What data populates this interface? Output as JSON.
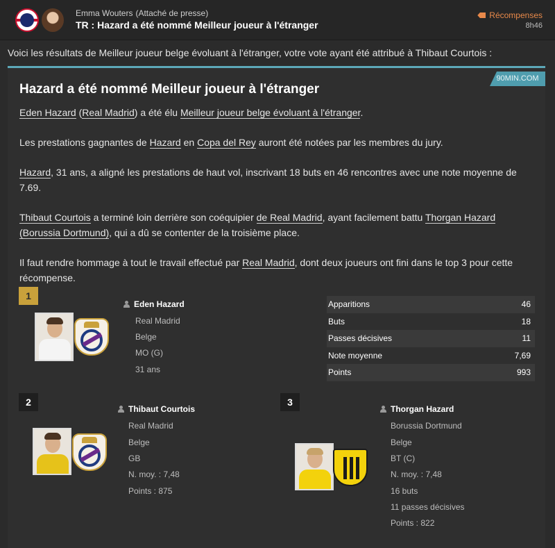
{
  "header": {
    "sender_name": "Emma Wouters",
    "sender_role": "(Attaché de presse)",
    "subject": "TR : Hazard a été nommé Meilleur joueur à l'étranger",
    "category_label": "Récompenses",
    "time": "8h46"
  },
  "intro": {
    "text_prefix": "Voici les résultats de Meilleur joueur belge évoluant à l'étranger, votre vote ayant été attribué à ",
    "voted_player": "Thibaut Courtois",
    "text_suffix": " :"
  },
  "article": {
    "source": "90MIN.COM",
    "headline": "Hazard a été nommé Meilleur joueur à l'étranger",
    "p1": {
      "player": "Eden Hazard",
      "club_open": "(",
      "club": "Real Madrid",
      "club_close": ")",
      "text1": " a été élu ",
      "award": "Meilleur joueur belge évoluant à l'étranger",
      "text2": "."
    },
    "p2": {
      "text1": "Les prestations gagnantes de ",
      "player": "Hazard",
      "text2": " en ",
      "competition": "Copa del Rey",
      "text3": " auront été notées par les membres du jury."
    },
    "p3": {
      "player": "Hazard",
      "text": ", 31 ans, a aligné les prestations de haut vol, inscrivant 18 buts en 46 rencontres avec une note moyenne de 7.69."
    },
    "p4": {
      "player": "Thibaut Courtois",
      "text1": " a terminé loin derrière son coéquipier ",
      "club": "de Real Madrid",
      "text2": ", ayant facilement battu ",
      "player2": "Thorgan Hazard",
      "text3": " ",
      "club2": "(Borussia Dortmund)",
      "text4": ", qui a dû se contenter de la troisième place."
    },
    "p5": {
      "text1": "Il faut rendre hommage à tout le travail effectué par ",
      "club": "Real Madrid",
      "text2": ", dont deux joueurs ont fini dans le top 3 pour cette récompense."
    }
  },
  "winners": [
    {
      "rank": "1",
      "name": "Eden Hazard",
      "club": "Real Madrid",
      "nationality": "Belge",
      "position": "MO (G)",
      "age": "31 ans",
      "stats": [
        {
          "label": "Apparitions",
          "value": "46"
        },
        {
          "label": "Buts",
          "value": "18"
        },
        {
          "label": "Passes décisives",
          "value": "11"
        },
        {
          "label": "Note moyenne",
          "value": "7,69"
        },
        {
          "label": "Points",
          "value": "993"
        }
      ]
    },
    {
      "rank": "2",
      "name": "Thibaut Courtois",
      "club": "Real Madrid",
      "nationality": "Belge",
      "position": "GB",
      "rating": "N. moy. : 7,48",
      "points": "Points : 875"
    },
    {
      "rank": "3",
      "name": "Thorgan Hazard",
      "club": "Borussia Dortmund",
      "nationality": "Belge",
      "position": "BT (C)",
      "rating": "N. moy. : 7,48",
      "goals": "16 buts",
      "assists": "11 passes décisives",
      "points": "Points : 822"
    }
  ],
  "colors": {
    "accent": "#e8894a",
    "gold": "#c9a13b",
    "source_badge": "#4f9dae"
  }
}
